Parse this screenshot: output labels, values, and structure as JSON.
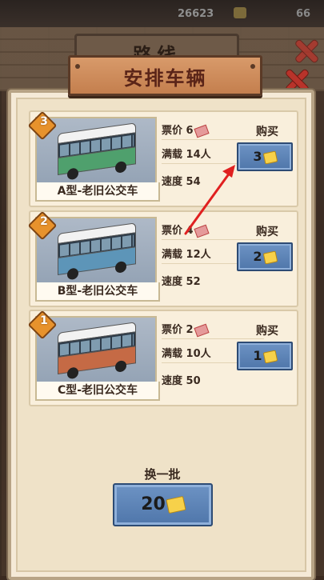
{
  "hud": {
    "coins": "26623",
    "right_value": "66"
  },
  "back_sign": {
    "title": "路线"
  },
  "dialog": {
    "title": "安排车辆",
    "buy_label": "购买",
    "stats_labels": {
      "fare": "票价",
      "capacity": "满载",
      "speed": "速度"
    },
    "vehicles": [
      {
        "rank": "3",
        "name": "A型-老旧公交车",
        "fare": "6",
        "capacity": "14人",
        "speed": "54",
        "price": "3",
        "stripe_color": "#4fa06d"
      },
      {
        "rank": "2",
        "name": "B型-老旧公交车",
        "fare": "4",
        "capacity": "12人",
        "speed": "52",
        "price": "2",
        "stripe_color": "#5d95b8"
      },
      {
        "rank": "1",
        "name": "C型-老旧公交车",
        "fare": "2",
        "capacity": "10人",
        "speed": "50",
        "price": "1",
        "stripe_color": "#c56a45"
      }
    ],
    "refresh": {
      "label": "换一批",
      "price": "20"
    }
  },
  "colors": {
    "accent_button": "#5b82b8",
    "title_board": "#d08c5c",
    "close_x": "#b8332a",
    "arrow": "#e02020"
  },
  "icons": [
    "close-icon",
    "ticket-icon",
    "gold-ingot-icon",
    "rank-badge-icon"
  ]
}
